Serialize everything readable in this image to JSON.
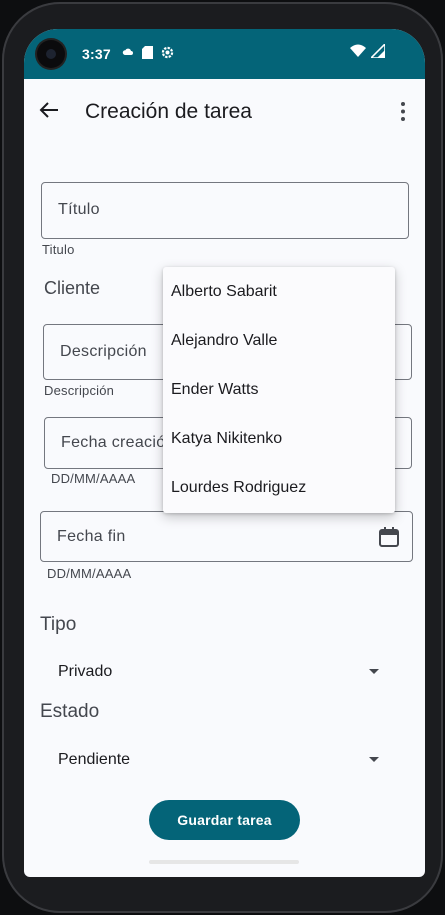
{
  "status_bar": {
    "time": "3:37",
    "icons": [
      "cloud-icon",
      "sd-card-icon",
      "settings-icon"
    ],
    "right_icons": [
      "wifi-icon",
      "signal-icon"
    ]
  },
  "app_bar": {
    "title": "Creación de tarea",
    "back_icon": "arrow-back-icon",
    "more_icon": "more-vert-icon"
  },
  "form": {
    "titulo": {
      "placeholder": "Título",
      "helper": "Titulo"
    },
    "cliente": {
      "label": "Cliente"
    },
    "descripcion": {
      "placeholder": "Descripción",
      "helper": "Descripción"
    },
    "fecha_creacion": {
      "placeholder": "Fecha creación",
      "helper": "DD/MM/AAAA"
    },
    "fecha_fin": {
      "placeholder": "Fecha fin",
      "helper": "DD/MM/AAAA",
      "icon": "calendar-icon"
    },
    "tipo": {
      "label": "Tipo",
      "value": "Privado"
    },
    "estado": {
      "label": "Estado",
      "value": "Pendiente"
    },
    "save_label": "Guardar tarea"
  },
  "client_dropdown": {
    "items": [
      "Alberto Sabarit",
      "Alejandro Valle",
      "Ender Watts",
      "Katya Nikitenko",
      "Lourdes Rodriguez"
    ]
  },
  "colors": {
    "primary": "#046478",
    "background": "#f9fafd",
    "outline": "#74777f",
    "text": "#1b1b1f"
  }
}
